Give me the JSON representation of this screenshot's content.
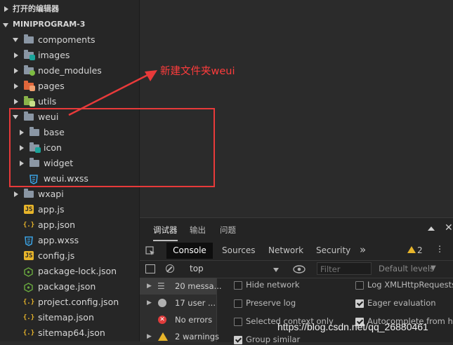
{
  "sidebar": {
    "open_editors": "打开的编辑器",
    "project": "MINIPROGRAM-3",
    "items": [
      {
        "label": "compoments",
        "icon": "folder-icon"
      },
      {
        "label": "images",
        "icon": "images-folder-icon"
      },
      {
        "label": "node_modules",
        "icon": "node-modules-folder-icon"
      },
      {
        "label": "pages",
        "icon": "pages-folder-icon"
      },
      {
        "label": "utils",
        "icon": "utils-folder-icon"
      },
      {
        "label": "weui",
        "icon": "folder-icon"
      },
      {
        "label": "base",
        "icon": "folder-icon"
      },
      {
        "label": "icon",
        "icon": "images-folder-icon"
      },
      {
        "label": "widget",
        "icon": "folder-icon"
      },
      {
        "label": "weui.wxss",
        "icon": "css-file-icon"
      },
      {
        "label": "wxapi",
        "icon": "folder-icon"
      },
      {
        "label": "app.js",
        "icon": "js-file-icon",
        "tag": "JS"
      },
      {
        "label": "app.json",
        "icon": "json-file-icon",
        "tag": "{.}"
      },
      {
        "label": "app.wxss",
        "icon": "css-file-icon"
      },
      {
        "label": "config.js",
        "icon": "js-file-icon",
        "tag": "JS"
      },
      {
        "label": "package-lock.json",
        "icon": "npm-file-icon"
      },
      {
        "label": "package.json",
        "icon": "npm-file-icon"
      },
      {
        "label": "project.config.json",
        "icon": "json-file-icon",
        "tag": "{.}"
      },
      {
        "label": "sitemap.json",
        "icon": "json-file-icon",
        "tag": "{.}"
      },
      {
        "label": "sitemap64.json",
        "icon": "json-file-icon",
        "tag": "{.}"
      }
    ]
  },
  "annotation": {
    "text": "新建文件夹weui",
    "color": "#e83a3a"
  },
  "devtools": {
    "panel_tabs": [
      "调试器",
      "输出",
      "问题"
    ],
    "tabs": [
      "Console",
      "Sources",
      "Network",
      "Security"
    ],
    "more": "»",
    "warning_count": "2",
    "context": "top",
    "filter_placeholder": "Filter",
    "levels": "Default levels",
    "messages": [
      {
        "icon": "list-icon",
        "text": "20 messa..."
      },
      {
        "icon": "user-icon",
        "text": "17 user ..."
      },
      {
        "icon": "error-icon",
        "text": "No errors"
      },
      {
        "icon": "warning-icon",
        "text": "2 warnings"
      }
    ],
    "options": [
      {
        "label": "Hide network",
        "checked": false
      },
      {
        "label": "Log XMLHttpRequests",
        "checked": false
      },
      {
        "label": "Preserve log",
        "checked": false
      },
      {
        "label": "Eager evaluation",
        "checked": true
      },
      {
        "label": "Selected context only",
        "checked": false
      },
      {
        "label": "Autocomplete from his",
        "checked": true
      },
      {
        "label": "Group similar",
        "checked": true
      }
    ]
  },
  "watermark": "https://blog.csdn.net/qq_26880461",
  "colors": {
    "accent_red": "#e83a3a",
    "console_tab": "#0e0e0e"
  }
}
